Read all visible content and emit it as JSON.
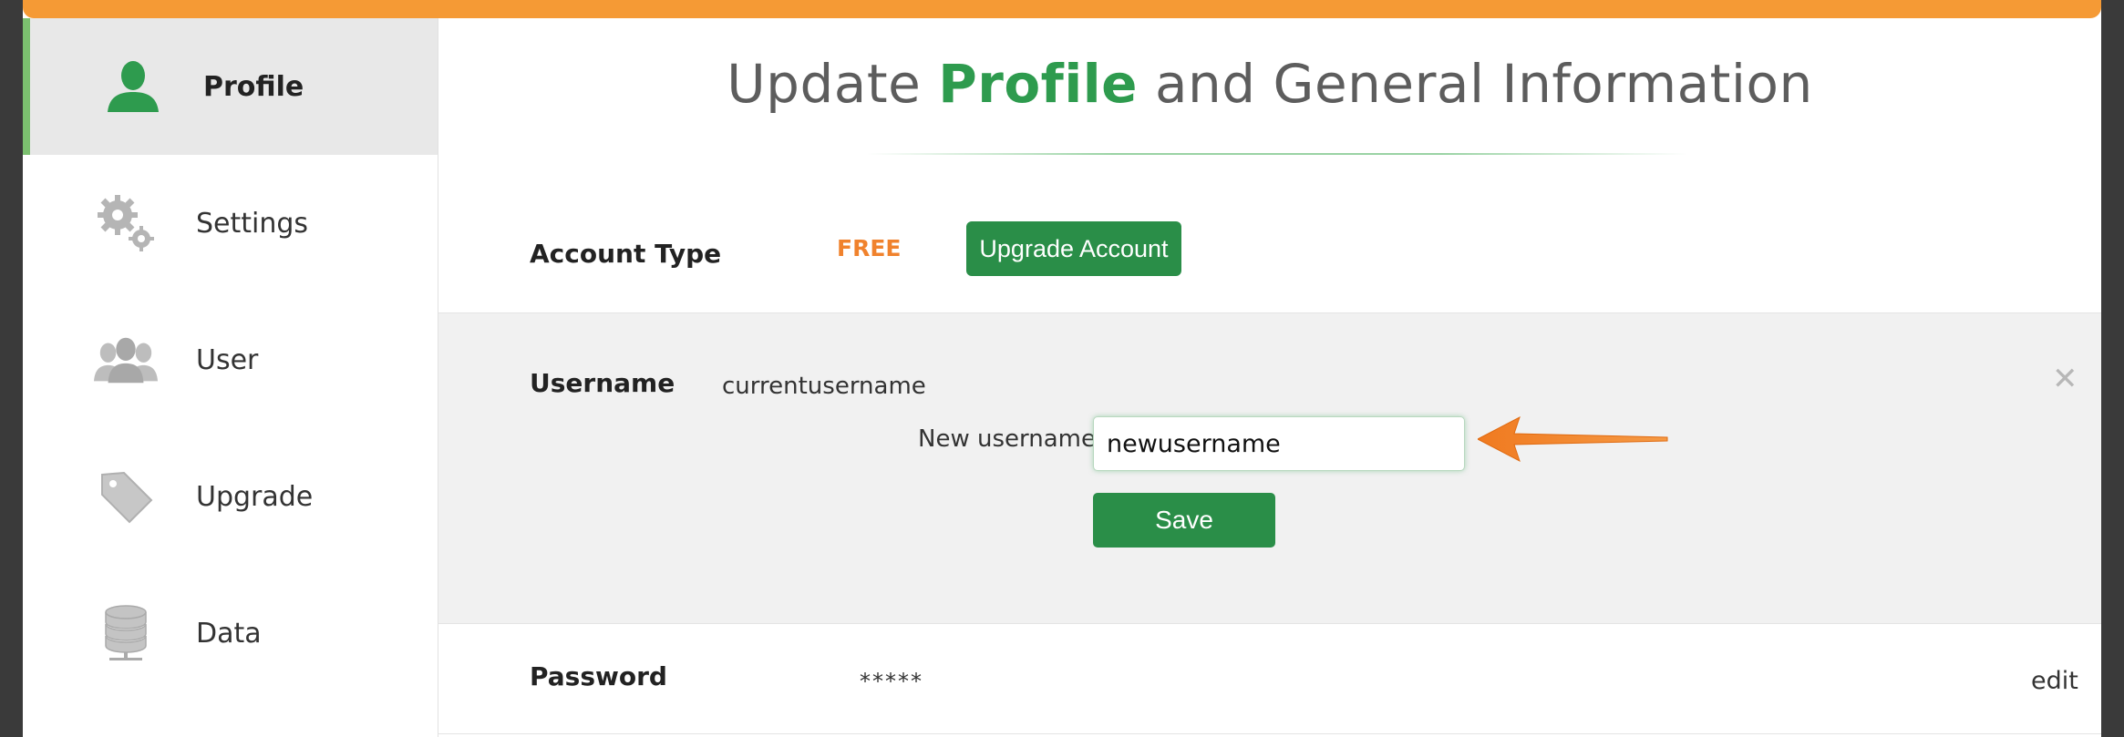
{
  "sidebar": {
    "items": [
      {
        "label": "Profile",
        "icon": "user-silhouette-icon",
        "active": true
      },
      {
        "label": "Settings",
        "icon": "gears-icon",
        "active": false
      },
      {
        "label": "User",
        "icon": "users-group-icon",
        "active": false
      },
      {
        "label": "Upgrade",
        "icon": "tag-icon",
        "active": false
      },
      {
        "label": "Data",
        "icon": "database-icon",
        "active": false
      }
    ]
  },
  "header": {
    "title_prefix": "Update ",
    "title_accent": "Profile",
    "title_suffix": " and General Information"
  },
  "account": {
    "label": "Account Type",
    "type": "FREE",
    "upgrade_label": "Upgrade Account"
  },
  "username": {
    "label": "Username",
    "current": "currentusername",
    "new_label": "New username",
    "new_value": "newusername",
    "save_label": "Save",
    "close_glyph": "✕"
  },
  "password": {
    "label": "Password",
    "value": "*****",
    "edit_label": "edit"
  },
  "colors": {
    "accent_green": "#2e9b4e",
    "button_green": "#2a8e48",
    "orange": "#f0822d",
    "top_bar": "#f59a35"
  }
}
